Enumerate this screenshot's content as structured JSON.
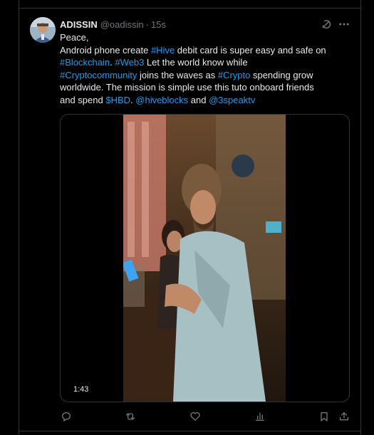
{
  "post": {
    "display_name": "ADISSIN",
    "handle": "@oadissin",
    "separator": "·",
    "time": "15s",
    "text": {
      "line1": "Peace,",
      "line2_a": "Android phone create ",
      "line2_tag": "#Hive",
      "line2_b": " debit card is super easy and safe on",
      "line3_tag1": "#Blockchain",
      "line3_a": ". ",
      "line3_tag2": "#Web3",
      "line3_b": " Let the world know while",
      "line4_tag1": "#Cryptocommunity",
      "line4_a": " joins the waves as ",
      "line4_tag2": "#Crypto",
      "line4_b": " spending grow",
      "line5": "worldwide. The mission is simple use this tuto onboard friends",
      "line6_a": "and spend ",
      "line6_cashtag": "$HBD",
      "line6_b": ". ",
      "line6_mention1": "@hiveblocks",
      "line6_c": " and ",
      "line6_mention2": "@3speaktv"
    },
    "media": {
      "duration": "1:43"
    }
  },
  "icons": {
    "grok": "grok-icon",
    "more": "more-icon",
    "reply": "reply-icon",
    "repost": "repost-icon",
    "like": "like-icon",
    "views": "views-icon",
    "bookmark": "bookmark-icon",
    "share": "share-icon"
  },
  "colors": {
    "background": "#000000",
    "text": "#e7e9ea",
    "secondary": "#71767b",
    "link": "#1d9bf0",
    "border": "#2f3336"
  }
}
